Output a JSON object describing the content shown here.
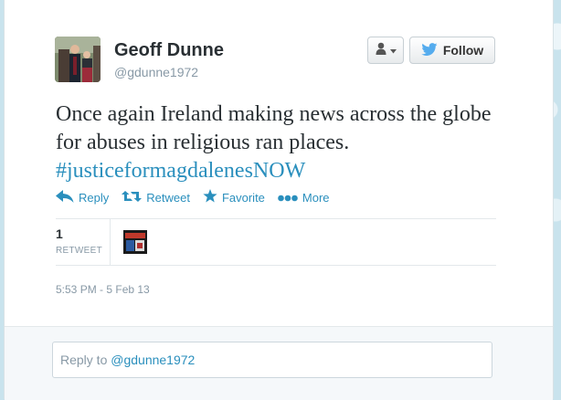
{
  "user": {
    "name": "Geoff Dunne",
    "handle": "@gdunne1972"
  },
  "buttons": {
    "follow_label": "Follow"
  },
  "tweet": {
    "text": "Once again Ireland making news across the globe for abuses in religious ran places.",
    "hashtag": "#justiceformagdalenesNOW"
  },
  "actions": {
    "reply": "Reply",
    "retweet": "Retweet",
    "favorite": "Favorite",
    "more": "More"
  },
  "stats": {
    "retweet_count": "1",
    "retweet_label": "RETWEET"
  },
  "timestamp": "5:53 PM - 5 Feb 13",
  "reply_box": {
    "prefix": "Reply to ",
    "mention": "@gdunne1972"
  },
  "colors": {
    "link": "#2a8fbd",
    "twitter_bird": "#55acee",
    "page_background": "#c9e3ed"
  }
}
